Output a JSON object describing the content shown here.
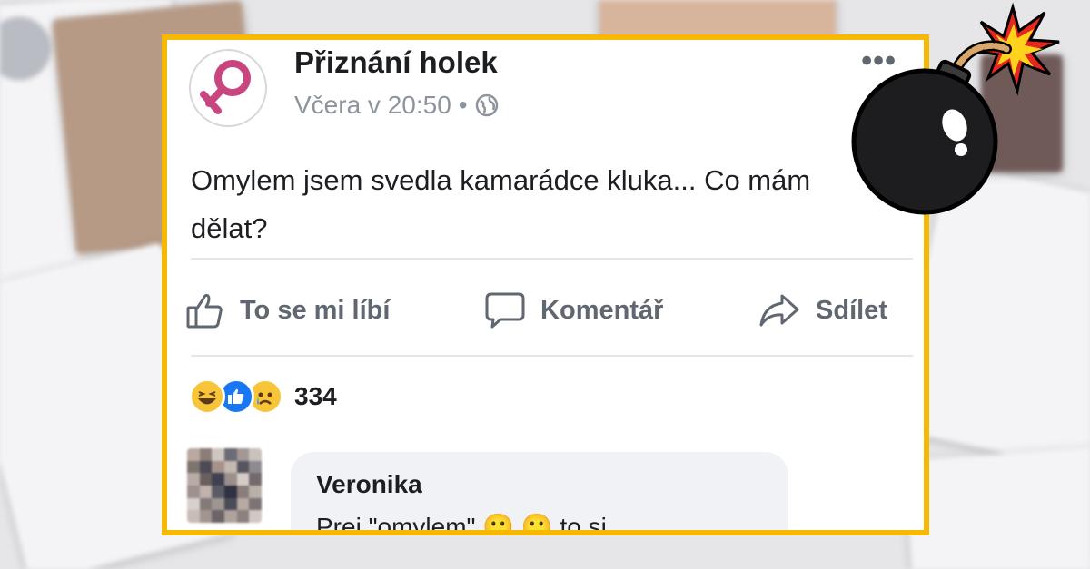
{
  "post": {
    "page_name": "Přiznání holek",
    "timestamp": "Včera v 20:50",
    "privacy_icon": "globe-icon",
    "more_label": "•••",
    "text": "Omylem jsem svedla kamarádce kluka... Co mám dělat?",
    "actions": {
      "like": "To se mi líbí",
      "comment": "Komentář",
      "share": "Sdílet"
    },
    "reactions": {
      "icons": [
        "haha-icon",
        "like-icon",
        "sad-icon"
      ],
      "count": "334"
    },
    "comment": {
      "author": "Veronika",
      "text": "Prej \"omylem\" 🙂 🙂 to si"
    }
  },
  "colors": {
    "frame": "#f6b800",
    "logo_pink": "#c8457f",
    "like_blue": "#1877f2",
    "reaction_yellow": "#f7c537"
  },
  "overlay_icon": "bomb-icon"
}
